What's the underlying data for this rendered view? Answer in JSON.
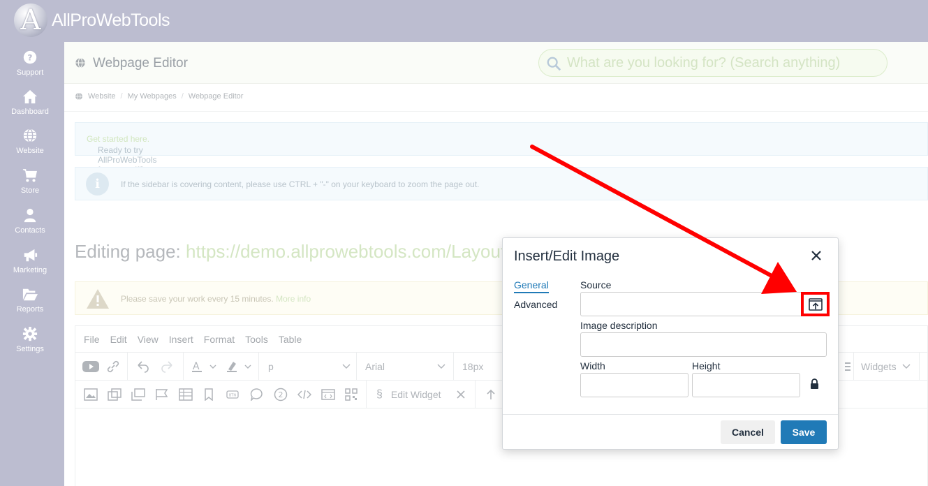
{
  "app": {
    "logo_text": "AllProWebTools",
    "logo_letter": "A"
  },
  "sidebar": {
    "items": [
      {
        "label": "Support",
        "icon": "question-circle-icon"
      },
      {
        "label": "Dashboard",
        "icon": "home-icon"
      },
      {
        "label": "Website",
        "icon": "globe-icon"
      },
      {
        "label": "Store",
        "icon": "cart-icon"
      },
      {
        "label": "Contacts",
        "icon": "user-icon"
      },
      {
        "label": "Marketing",
        "icon": "megaphone-icon"
      },
      {
        "label": "Reports",
        "icon": "folder-open-icon"
      },
      {
        "label": "Settings",
        "icon": "gear-icon"
      }
    ]
  },
  "header": {
    "title": "Webpage Editor",
    "search_placeholder": "What are you looking for? (Search anything)"
  },
  "breadcrumb": {
    "items": [
      "Website",
      "My Webpages",
      "Webpage Editor"
    ]
  },
  "alerts": {
    "trial_text": "Ready to try AllProWebTools for yourself?",
    "trial_link": "Get started here.",
    "zoom_text": "If the sidebar is covering content, please use CTRL + \"-\" on your keyboard to zoom the page out.",
    "save_text": "Please save your work every 15 minutes.",
    "save_link": "More info"
  },
  "editing": {
    "prefix": "Editing page:",
    "url": "https://demo.allprowebtools.com/Layouts"
  },
  "editor": {
    "menu": [
      "File",
      "Edit",
      "View",
      "Insert",
      "Format",
      "Tools",
      "Table"
    ],
    "block_format": "p",
    "font_family": "Arial",
    "font_size": "18px",
    "widgets_label": "Widgets",
    "edit_widget_label": "Edit Widget"
  },
  "modal": {
    "title": "Insert/Edit Image",
    "tabs": {
      "general": "General",
      "advanced": "Advanced"
    },
    "source_label": "Source",
    "source_value": "",
    "description_label": "Image description",
    "description_value": "",
    "width_label": "Width",
    "width_value": "",
    "height_label": "Height",
    "height_value": "",
    "cancel_label": "Cancel",
    "save_label": "Save"
  },
  "colors": {
    "sidebar": "#bcbdd0",
    "primary": "#207ab7",
    "highlight": "#ff0000"
  }
}
